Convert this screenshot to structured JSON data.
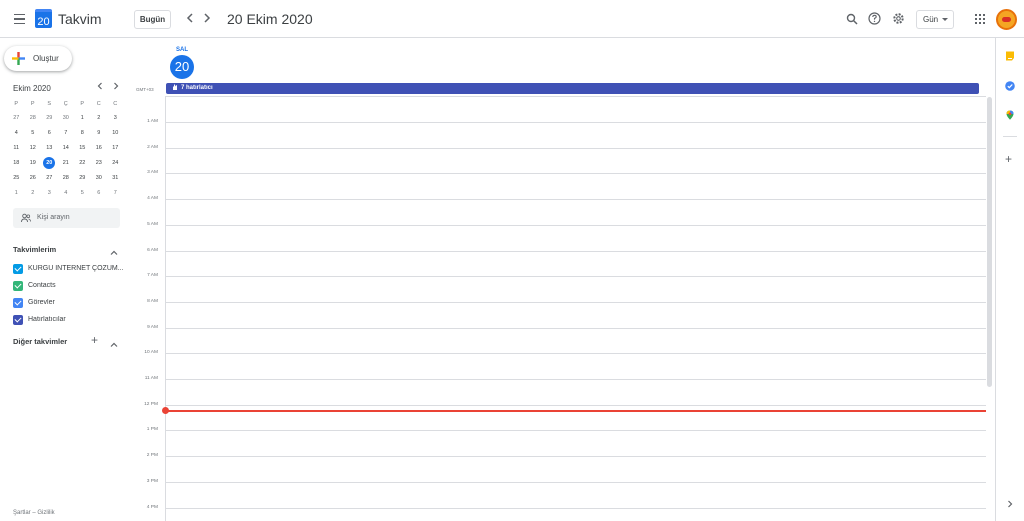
{
  "app": {
    "name": "Takvim",
    "logo_day": "20"
  },
  "header": {
    "today_label": "Bugün",
    "prev_icon": "chevron-left-icon",
    "next_icon": "chevron-right-icon",
    "date_title": "20 Ekim 2020",
    "view_label": "Gün",
    "icons": [
      "search-icon",
      "help-icon",
      "gear-icon",
      "apps-icon"
    ]
  },
  "sidebar": {
    "create_label": "Oluştur",
    "mini_calendar": {
      "title": "Ekim 2020",
      "weekdays": [
        "P",
        "P",
        "S",
        "Ç",
        "P",
        "C",
        "C"
      ],
      "weeks": [
        [
          "27",
          "28",
          "29",
          "30",
          "1",
          "2",
          "3"
        ],
        [
          "4",
          "5",
          "6",
          "7",
          "8",
          "9",
          "10"
        ],
        [
          "11",
          "12",
          "13",
          "14",
          "15",
          "16",
          "17"
        ],
        [
          "18",
          "19",
          "20",
          "21",
          "22",
          "23",
          "24"
        ],
        [
          "25",
          "26",
          "27",
          "28",
          "29",
          "30",
          "31"
        ],
        [
          "1",
          "2",
          "3",
          "4",
          "5",
          "6",
          "7"
        ]
      ],
      "selected_day": "20"
    },
    "people_search_placeholder": "Kişi arayın",
    "my_calendars_title": "Takvimlerim",
    "my_calendars": [
      {
        "label": "KURGU İNTERNET ÇÖZÜM...",
        "color": "#039be5"
      },
      {
        "label": "Contacts",
        "color": "#33b679"
      },
      {
        "label": "Görevler",
        "color": "#4285f4"
      },
      {
        "label": "Hatırlatıcılar",
        "color": "#3f51b5"
      }
    ],
    "other_calendars_title": "Diğer takvimler",
    "footer": "Şartlar – Gizlilik"
  },
  "day_view": {
    "weekday": "SAL",
    "day_number": "20",
    "timezone": "GMT+03",
    "allday_event": "7 hatırlatıcı",
    "allday_event_color": "#3f51b5",
    "hours": [
      "1 AM",
      "2 AM",
      "3 AM",
      "4 AM",
      "5 AM",
      "6 AM",
      "7 AM",
      "8 AM",
      "9 AM",
      "10 AM",
      "11 AM",
      "12 PM",
      "1 PM",
      "2 PM",
      "3 PM",
      "4 PM"
    ],
    "now_indicator_color": "#ea4335"
  },
  "right_rail": {
    "icons": [
      "keep-icon",
      "tasks-icon",
      "maps-icon"
    ],
    "add_icon": "plus-icon",
    "expand_icon": "chevron-right-icon"
  }
}
